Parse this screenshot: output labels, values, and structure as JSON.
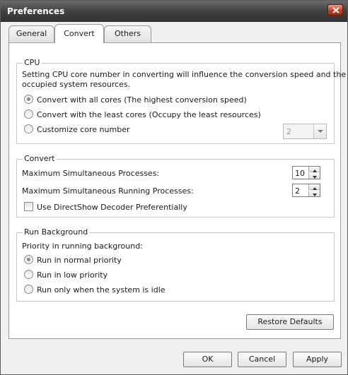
{
  "window": {
    "title": "Preferences"
  },
  "tabs": [
    {
      "label": "General",
      "active": false
    },
    {
      "label": "Convert",
      "active": true
    },
    {
      "label": "Others",
      "active": false
    }
  ],
  "cpu": {
    "legend": "CPU",
    "description_line1": "Setting CPU core number in converting will influence the conversion speed and the",
    "description_line2": "occupied system resources.",
    "options": [
      {
        "label": "Convert with all cores (The highest conversion speed)",
        "checked": true
      },
      {
        "label": "Convert with the least cores (Occupy the least resources)",
        "checked": false
      },
      {
        "label": "Customize core number",
        "checked": false
      }
    ],
    "core_number": "2"
  },
  "convert": {
    "legend": "Convert",
    "max_processes_label": "Maximum Simultaneous Processes:",
    "max_processes_value": "10",
    "max_running_label": "Maximum Simultaneous Running Processes:",
    "max_running_value": "2",
    "directshow_label": "Use DirectShow Decoder Preferentially",
    "directshow_checked": false
  },
  "background": {
    "legend": "Run Background",
    "priority_label": "Priority in running background:",
    "options": [
      {
        "label": "Run in normal priority",
        "checked": true
      },
      {
        "label": "Run in low priority",
        "checked": false
      },
      {
        "label": "Run only when the system is idle",
        "checked": false
      }
    ]
  },
  "buttons": {
    "restore": "Restore Defaults",
    "ok": "OK",
    "cancel": "Cancel",
    "apply": "Apply"
  },
  "colors": {
    "titlebar": "#3f3f3f",
    "close": "#c0432b",
    "panel": "#ffffff",
    "dialog": "#f0f0f0"
  }
}
